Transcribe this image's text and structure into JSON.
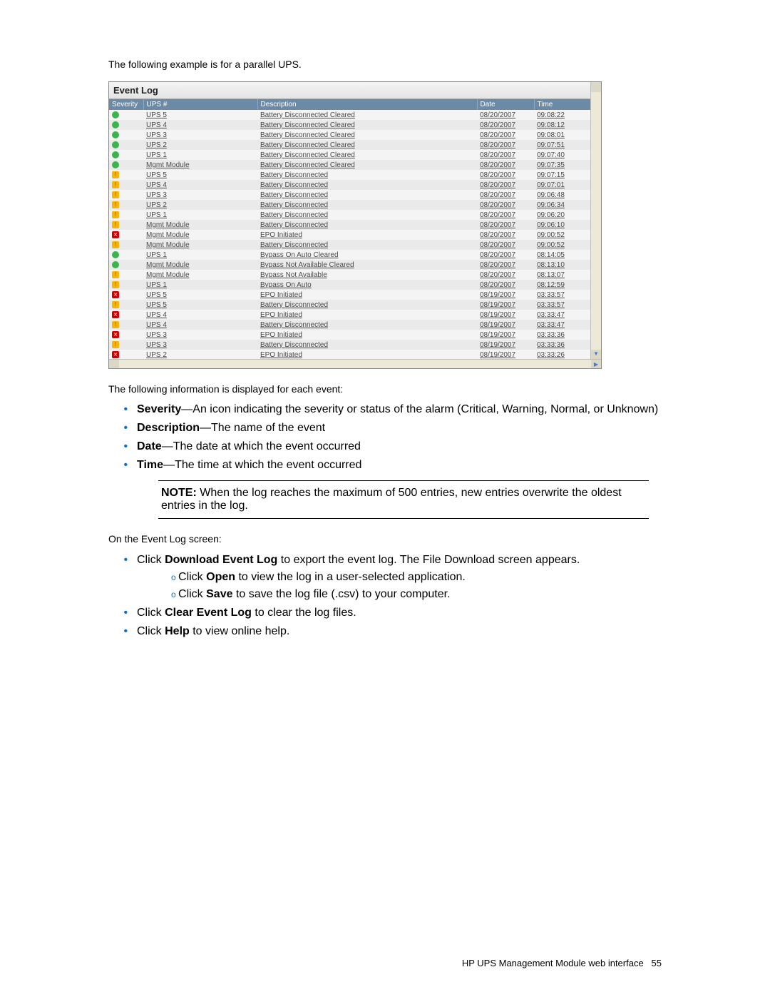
{
  "intro": "The following example is for a parallel UPS.",
  "log_panel_title": "Event Log",
  "headers": {
    "severity": "Severity",
    "ups": "UPS #",
    "desc": "Description",
    "date": "Date",
    "time": "Time"
  },
  "rows": [
    {
      "sev": "normal",
      "ups": "UPS 5",
      "desc": "Battery Disconnected Cleared",
      "date": "08/20/2007",
      "time": "09:08:22"
    },
    {
      "sev": "normal",
      "ups": "UPS 4",
      "desc": "Battery Disconnected Cleared",
      "date": "08/20/2007",
      "time": "09:08:12"
    },
    {
      "sev": "normal",
      "ups": "UPS 3",
      "desc": "Battery Disconnected Cleared",
      "date": "08/20/2007",
      "time": "09:08:01"
    },
    {
      "sev": "normal",
      "ups": "UPS 2",
      "desc": "Battery Disconnected Cleared",
      "date": "08/20/2007",
      "time": "09:07:51"
    },
    {
      "sev": "normal",
      "ups": "UPS 1",
      "desc": "Battery Disconnected Cleared",
      "date": "08/20/2007",
      "time": "09:07:40"
    },
    {
      "sev": "normal",
      "ups": "Mgmt Module",
      "desc": "Battery Disconnected Cleared",
      "date": "08/20/2007",
      "time": "09:07:35"
    },
    {
      "sev": "warning",
      "ups": "UPS 5",
      "desc": "Battery Disconnected",
      "date": "08/20/2007",
      "time": "09:07:15"
    },
    {
      "sev": "warning",
      "ups": "UPS 4",
      "desc": "Battery Disconnected",
      "date": "08/20/2007",
      "time": "09:07:01"
    },
    {
      "sev": "warning",
      "ups": "UPS 3",
      "desc": "Battery Disconnected",
      "date": "08/20/2007",
      "time": "09:06:48"
    },
    {
      "sev": "warning",
      "ups": "UPS 2",
      "desc": "Battery Disconnected",
      "date": "08/20/2007",
      "time": "09:06:34"
    },
    {
      "sev": "warning",
      "ups": "UPS 1",
      "desc": "Battery Disconnected",
      "date": "08/20/2007",
      "time": "09:06:20"
    },
    {
      "sev": "warning",
      "ups": "Mgmt Module",
      "desc": "Battery Disconnected",
      "date": "08/20/2007",
      "time": "09:06:10"
    },
    {
      "sev": "critical",
      "ups": "Mgmt Module",
      "desc": "EPO Initiated",
      "date": "08/20/2007",
      "time": "09:00:52"
    },
    {
      "sev": "warning",
      "ups": "Mgmt Module",
      "desc": "Battery Disconnected",
      "date": "08/20/2007",
      "time": "09:00:52"
    },
    {
      "sev": "normal",
      "ups": "UPS 1",
      "desc": "Bypass On Auto Cleared",
      "date": "08/20/2007",
      "time": "08:14:05"
    },
    {
      "sev": "normal",
      "ups": "Mgmt Module",
      "desc": "Bypass Not Available Cleared",
      "date": "08/20/2007",
      "time": "08:13:10"
    },
    {
      "sev": "warning",
      "ups": "Mgmt Module",
      "desc": "Bypass Not Available",
      "date": "08/20/2007",
      "time": "08:13:07"
    },
    {
      "sev": "warning",
      "ups": "UPS 1",
      "desc": "Bypass On Auto",
      "date": "08/20/2007",
      "time": "08:12:59"
    },
    {
      "sev": "critical",
      "ups": "UPS 5",
      "desc": "EPO Initiated",
      "date": "08/19/2007",
      "time": "03:33:57"
    },
    {
      "sev": "warning",
      "ups": "UPS 5",
      "desc": "Battery Disconnected",
      "date": "08/19/2007",
      "time": "03:33:57"
    },
    {
      "sev": "critical",
      "ups": "UPS 4",
      "desc": "EPO Initiated",
      "date": "08/19/2007",
      "time": "03:33:47"
    },
    {
      "sev": "warning",
      "ups": "UPS 4",
      "desc": "Battery Disconnected",
      "date": "08/19/2007",
      "time": "03:33:47"
    },
    {
      "sev": "critical",
      "ups": "UPS 3",
      "desc": "EPO Initiated",
      "date": "08/19/2007",
      "time": "03:33:36"
    },
    {
      "sev": "warning",
      "ups": "UPS 3",
      "desc": "Battery Disconnected",
      "date": "08/19/2007",
      "time": "03:33:36"
    },
    {
      "sev": "critical",
      "ups": "UPS 2",
      "desc": "EPO Initiated",
      "date": "08/19/2007",
      "time": "03:33:26"
    }
  ],
  "post_text": "The following information is displayed for each event:",
  "bullets1": [
    {
      "b": "Severity",
      "t": "—An icon indicating the severity or status of the alarm (Critical, Warning, Normal, or Unknown)"
    },
    {
      "b": "Description",
      "t": "—The name of the event"
    },
    {
      "b": "Date",
      "t": "—The date at which the event occurred"
    },
    {
      "b": "Time",
      "t": "—The time at which the event occurred"
    }
  ],
  "note_label": "NOTE:",
  "note_text": "When the log reaches the maximum of 500 entries, new entries overwrite the oldest entries in the log.",
  "on_screen": "On the Event Log screen:",
  "bullets2": {
    "a_pre": "Click ",
    "a_b": "Download Event Log",
    "a_post": " to export the event log. The File Download screen appears.",
    "sub1_pre": "Click ",
    "sub1_b": "Open",
    "sub1_post": " to view the log in a user-selected application.",
    "sub2_pre": "Click ",
    "sub2_b": "Save",
    "sub2_post": " to save the log file (.csv) to your computer.",
    "b_pre": "Click ",
    "b_b": "Clear Event Log",
    "b_post": " to clear the log files.",
    "c_pre": "Click ",
    "c_b": "Help",
    "c_post": " to view online help."
  },
  "footer_text": "HP UPS Management Module web interface",
  "footer_page": "55"
}
